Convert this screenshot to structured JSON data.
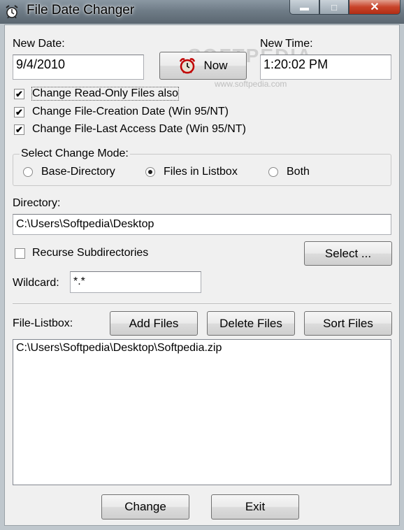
{
  "window": {
    "title": "File Date Changer"
  },
  "watermark": {
    "big": "SOFTPEDIA",
    "small": "www.softpedia.com"
  },
  "date": {
    "label": "New Date:",
    "value": "9/4/2010"
  },
  "time": {
    "label": "New Time:",
    "value": "1:20:02 PM"
  },
  "now_button": {
    "label": "Now",
    "icon": "alarm-clock-icon"
  },
  "options": [
    {
      "label": "Change Read-Only Files also",
      "checked": true
    },
    {
      "label": "Change File-Creation Date (Win 95/NT)",
      "checked": true
    },
    {
      "label": "Change File-Last Access Date (Win 95/NT)",
      "checked": true
    }
  ],
  "mode": {
    "title": "Select Change Mode:",
    "options": [
      {
        "label": "Base-Directory",
        "selected": false
      },
      {
        "label": "Files in Listbox",
        "selected": true
      },
      {
        "label": "Both",
        "selected": false
      }
    ]
  },
  "directory": {
    "label": "Directory:",
    "value": "C:\\Users\\Softpedia\\Desktop"
  },
  "recurse": {
    "label": "Recurse Subdirectories",
    "checked": false
  },
  "select_button": {
    "label": "Select ..."
  },
  "wildcard": {
    "label": "Wildcard:",
    "value": "*.*"
  },
  "file_listbox": {
    "label": "File-Listbox:",
    "items": [
      "C:\\Users\\Softpedia\\Desktop\\Softpedia.zip"
    ]
  },
  "buttons": {
    "add": "Add Files",
    "delete": "Delete Files",
    "sort": "Sort Files",
    "change": "Change",
    "exit": "Exit"
  }
}
